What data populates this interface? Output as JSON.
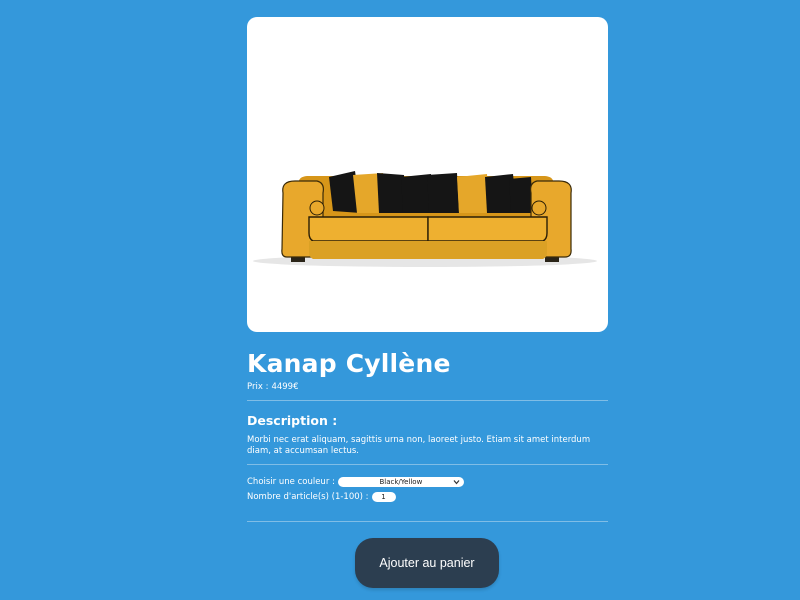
{
  "product": {
    "image_alt": "yellow sofa with black and yellow cushions",
    "name": "Kanap Cyllène",
    "price_label": "Prix :",
    "price_value": "4499€",
    "description_title": "Description :",
    "description_text": "Morbi nec erat aliquam, sagittis urna non, laoreet justo. Etiam sit amet interdum diam, at accumsan lectus."
  },
  "options": {
    "color_label": "Choisir une couleur :",
    "color_selected": "Black/Yellow",
    "quantity_label": "Nombre d'article(s) (1-100) :",
    "quantity_value": "1"
  },
  "cart": {
    "add_button_label": "Ajouter au panier"
  },
  "colors": {
    "background": "#3498db",
    "button": "#2c3e50",
    "sofa": "#e8a82c",
    "cushion_dark": "#141414"
  }
}
